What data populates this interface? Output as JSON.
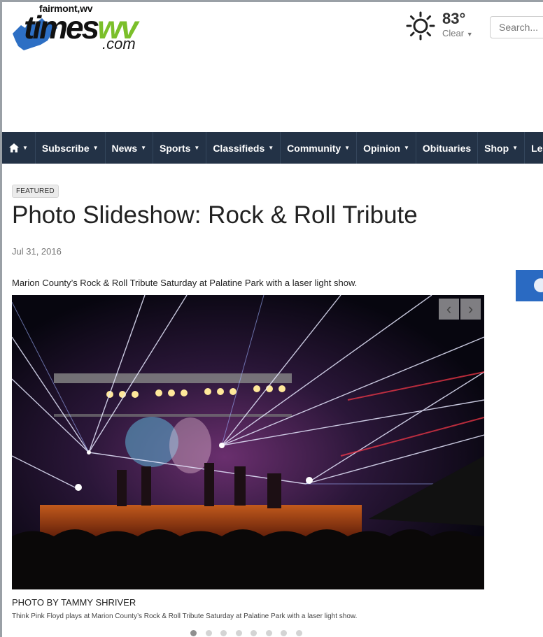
{
  "brand": {
    "tagline": "fairmont,wv",
    "name_part1": "times",
    "name_part2": "wv",
    "name_suffix": ".com",
    "accent_color": "#7bbf2a",
    "state_color": "#2d6fc4"
  },
  "weather": {
    "icon": "sun-icon",
    "temperature": "83°",
    "condition": "Clear"
  },
  "search": {
    "placeholder": "Search..."
  },
  "nav": {
    "background": "#233246",
    "home_icon": "home-icon",
    "items": [
      {
        "label": "Subscribe"
      },
      {
        "label": "News"
      },
      {
        "label": "Sports"
      },
      {
        "label": "Classifieds"
      },
      {
        "label": "Community"
      },
      {
        "label": "Opinion"
      },
      {
        "label": "Obituaries"
      },
      {
        "label": "Shop"
      },
      {
        "label": "Legal Notices"
      }
    ]
  },
  "article": {
    "badge": "FEATURED",
    "headline": "Photo Slideshow: Rock & Roll Tribute",
    "date": "Jul 31, 2016",
    "summary": "Marion County’s Rock & Roll Tribute Saturday at Palatine Park with a laser light show.",
    "photo_credit": "PHOTO BY TAMMY SHRIVER",
    "caption": "Think Pink Floyd plays at Marion County’s Rock & Roll Tribute Saturday at Palatine Park with a laser light show."
  },
  "slideshow": {
    "prev_label": "‹",
    "next_label": "›",
    "slide_count": 8,
    "active_index": 0
  }
}
